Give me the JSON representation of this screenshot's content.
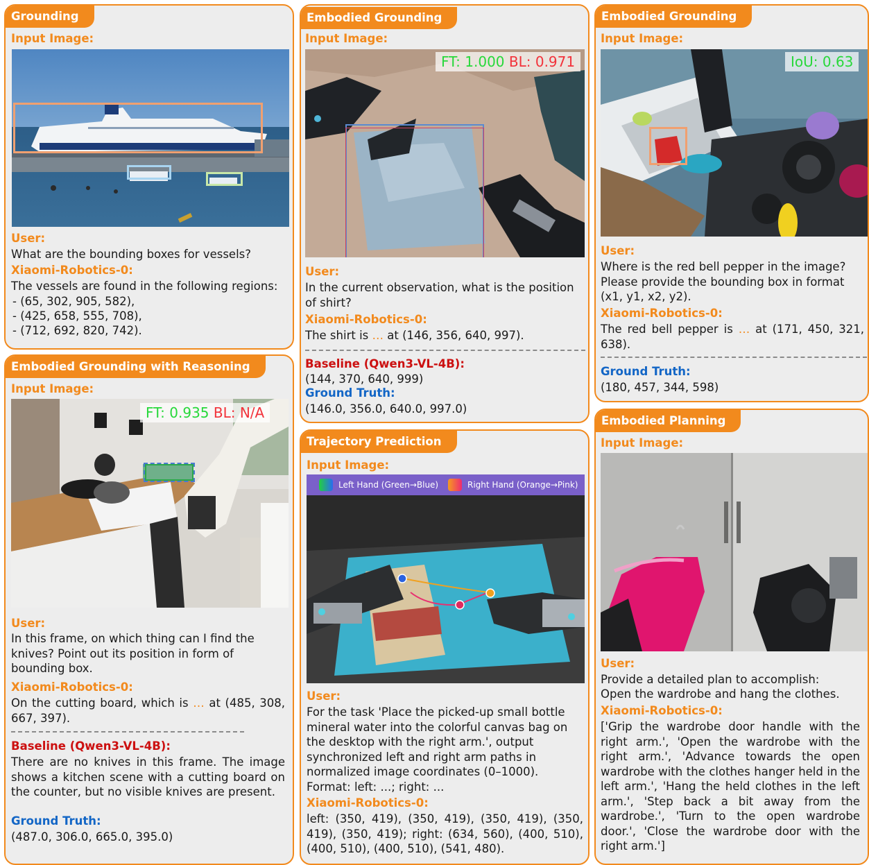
{
  "colors": {
    "accent": "#f28a1d",
    "baseline": "#cc1010",
    "ground_truth": "#1366c6",
    "score_good": "#27d83a",
    "score_bad": "#f2323a"
  },
  "p1": {
    "tag": "Grounding",
    "input_label": "Input Image:",
    "user_label": "User:",
    "user_text": "What are the bounding boxes for vessels?",
    "model_label": "Xiaomi-Robotics-0:",
    "answer_intro": "The vessels are found in the following regions:",
    "regions": [
      "- (65, 302, 905, 582),",
      "- (425, 658, 555, 708),",
      "- (712, 692, 820, 742)."
    ]
  },
  "p2": {
    "tag": "Embodied Grounding",
    "input_label": "Input Image:",
    "score_ft": "FT: 1.000",
    "score_bl": "BL: 0.971",
    "user_label": "User:",
    "user_text": "In the current observation, what is the position of shirt?",
    "model_label": "Xiaomi-Robotics-0:",
    "answer_pre": "The shirt is",
    "ellipsis": "…",
    "answer_post": "at (146, 356, 640, 997).",
    "baseline_label": "Baseline (Qwen3-VL-4B):",
    "baseline_text": "(144, 370, 640, 999)",
    "gt_label": "Ground Truth:",
    "gt_text": "(146.0, 356.0, 640.0, 997.0)"
  },
  "p3": {
    "tag": "Embodied Grounding",
    "input_label": "Input Image:",
    "score_iou": "IoU: 0.63",
    "user_label": "User:",
    "user_text": "Where is the red bell pepper in the image? Please provide the bounding box in format (x1, y1, x2, y2).",
    "model_label": "Xiaomi-Robotics-0:",
    "answer_pre": "The red bell pepper is",
    "ellipsis": "…",
    "answer_post": "at (171, 450, 321, 638).",
    "gt_label": "Ground Truth:",
    "gt_text": "(180, 457, 344, 598)"
  },
  "p4": {
    "tag": "Embodied Grounding with Reasoning",
    "input_label": "Input Image:",
    "score_ft": "FT: 0.935",
    "score_bl": "BL: N/A",
    "user_label": "User:",
    "user_text": "In this frame, on which thing can I find the knives? Point out its position in form of bounding box.",
    "model_label": "Xiaomi-Robotics-0:",
    "answer_pre": "On the cutting board, which is",
    "ellipsis": "…",
    "answer_post": "at (485, 308, 667, 397).",
    "baseline_label": "Baseline (Qwen3-VL-4B):",
    "baseline_text": "There are no knives in this frame. The image shows a kitchen scene with a cutting board on the counter, but no visible knives are present.",
    "gt_label": "Ground Truth:",
    "gt_text": "(487.0, 306.0, 665.0, 395.0)"
  },
  "p5": {
    "tag": "Trajectory Prediction",
    "input_label": "Input Image:",
    "legend_left": "Left Hand (Green→Blue)",
    "legend_right": "Right Hand (Orange→Pink)",
    "user_label": "User:",
    "user_text": "For the task 'Place the picked-up small bottle mineral water into the colorful canvas bag on the desktop with the right arm.', output synchronized left and right arm paths in normalized image coordinates (0–1000). Format: left: ...; right: ...",
    "model_label": "Xiaomi-Robotics-0:",
    "answer": "left: (350, 419), (350, 419), (350, 419), (350, 419), (350, 419); right: (634, 560), (400, 510), (400, 510), (400, 510), (541, 480)."
  },
  "p6": {
    "tag": "Embodied Planning",
    "input_label": "Input Image:",
    "user_label": "User:",
    "user_text_1": "Provide a detailed plan to accomplish:",
    "user_text_2": "Open the wardrobe and hang the clothes.",
    "model_label": "Xiaomi-Robotics-0:",
    "answer": "['Grip the wardrobe door handle with the right arm.', 'Open the wardrobe with the right arm.', 'Advance towards the open wardrobe with the clothes hanger held in the left arm.', 'Hang the held clothes in the left arm.', 'Step back a bit away from the wardrobe.', 'Turn to the open wardrobe door.', 'Close the wardrobe door with the right arm.']"
  }
}
